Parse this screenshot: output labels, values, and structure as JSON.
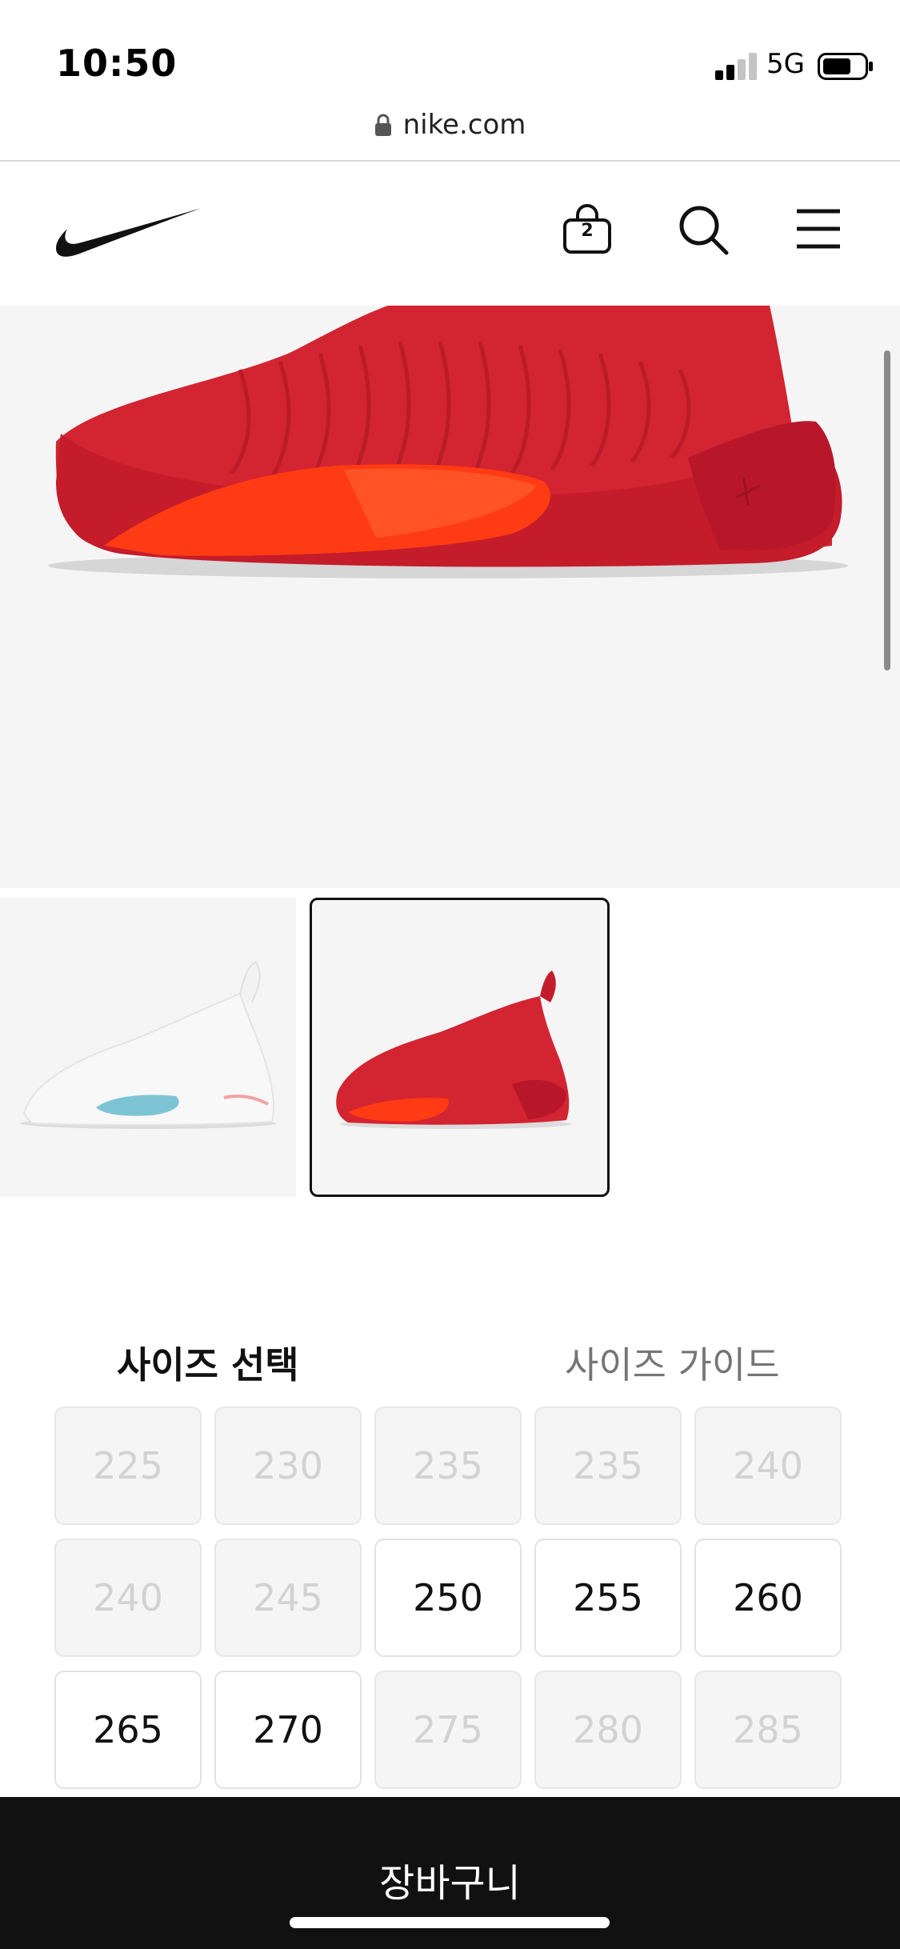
{
  "status_bar": {
    "time": "10:50",
    "network": "5G"
  },
  "browser": {
    "url": "nike.com"
  },
  "nav": {
    "logo_icon": "nike-swoosh-icon",
    "bag_count": "2",
    "bag_icon": "bag-icon",
    "search_icon": "search-icon",
    "menu_icon": "hamburger-menu-icon"
  },
  "colors": {
    "shoe_red": "#d8232f",
    "accent_orange": "#ff3b14",
    "cart_bar": "#111111"
  },
  "size_section": {
    "title": "사이즈 선택",
    "guide_link": "사이즈 가이드",
    "sizes": [
      {
        "label": "225",
        "available": false
      },
      {
        "label": "230",
        "available": false
      },
      {
        "label": "235",
        "available": false
      },
      {
        "label": "235",
        "available": false
      },
      {
        "label": "240",
        "available": false
      },
      {
        "label": "240",
        "available": false
      },
      {
        "label": "245",
        "available": false
      },
      {
        "label": "250",
        "available": true
      },
      {
        "label": "255",
        "available": true
      },
      {
        "label": "260",
        "available": true
      },
      {
        "label": "265",
        "available": true
      },
      {
        "label": "270",
        "available": true
      },
      {
        "label": "275",
        "available": false
      },
      {
        "label": "280",
        "available": false
      },
      {
        "label": "285",
        "available": false
      }
    ]
  },
  "cart_button": {
    "label": "장바구니"
  }
}
